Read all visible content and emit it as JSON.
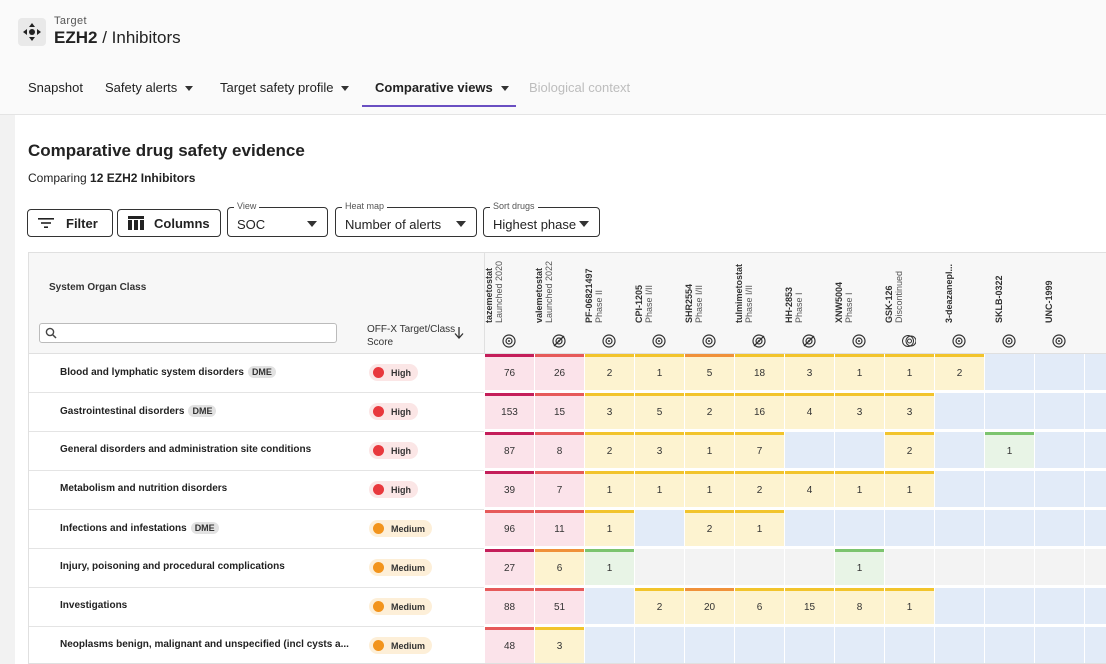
{
  "header": {
    "crumb_small": "Target",
    "target_name": "EZH2",
    "crumb_rest": "/ Inhibitors"
  },
  "tabs": [
    {
      "label": "Snapshot",
      "caret": false,
      "state": "normal"
    },
    {
      "label": "Safety alerts",
      "caret": true,
      "state": "normal"
    },
    {
      "label": "Target safety profile",
      "caret": true,
      "state": "normal"
    },
    {
      "label": "Comparative views",
      "caret": true,
      "state": "active"
    },
    {
      "label": "Biological context",
      "caret": false,
      "state": "disabled"
    }
  ],
  "panel": {
    "title": "Comparative drug safety evidence",
    "sub_prefix": "Comparing",
    "sub_bold": "12 EZH2 Inhibitors"
  },
  "toolbar": {
    "filter_label": "Filter",
    "columns_label": "Columns",
    "view": {
      "label": "View",
      "value": "SOC"
    },
    "heatmap": {
      "label": "Heat map",
      "value": "Number of alerts"
    },
    "sort": {
      "label": "Sort drugs",
      "value": "Highest phase"
    }
  },
  "table": {
    "soc_header": "System Organ Class",
    "score_header_line1": "OFF-X Target/Class",
    "score_header_line2": "Score",
    "drugs": [
      {
        "name": "tazemetostat",
        "phase": "Launched 2020",
        "icon": "target-icon"
      },
      {
        "name": "valemetostat",
        "phase": "Launched 2022",
        "icon": "target-crossed-icon"
      },
      {
        "name": "PF-06821497",
        "phase": "Phase II",
        "icon": "target-icon"
      },
      {
        "name": "CPI-1205",
        "phase": "Phase I/II",
        "icon": "target-icon"
      },
      {
        "name": "SHR2554",
        "phase": "Phase I/II",
        "icon": "target-icon"
      },
      {
        "name": "tulmimetostat",
        "phase": "Phase I/II",
        "icon": "target-crossed-icon"
      },
      {
        "name": "HH-2853",
        "phase": "Phase I",
        "icon": "target-crossed-icon"
      },
      {
        "name": "XNW5004",
        "phase": "Phase I",
        "icon": "target-icon"
      },
      {
        "name": "GSK-126",
        "phase": "Discontinued",
        "icon": "target-multi-icon"
      },
      {
        "name": "3-deazanepl...",
        "phase": "",
        "icon": "target-icon"
      },
      {
        "name": "SKLB-0322",
        "phase": "",
        "icon": "target-icon"
      },
      {
        "name": "UNC-1999",
        "phase": "",
        "icon": "target-icon"
      }
    ],
    "rows": [
      {
        "name": "Blood and lymphatic system disorders",
        "dme": "DME",
        "score": "High",
        "values": [
          "76",
          "26",
          "2",
          "1",
          "5",
          "18",
          "3",
          "1",
          "1",
          "2",
          "",
          ""
        ],
        "cell_fill": [
          "pk",
          "pk",
          "ye",
          "ye",
          "ye",
          "ye",
          "ye",
          "ye",
          "ye",
          "ye",
          "bl",
          "bl"
        ],
        "cell_bar": [
          "mg",
          "rd",
          "ye",
          "ye",
          "or",
          "ye",
          "ye",
          "ye",
          "ye",
          "ye",
          "",
          ""
        ]
      },
      {
        "name": "Gastrointestinal disorders",
        "dme": "DME",
        "score": "High",
        "values": [
          "153",
          "15",
          "3",
          "5",
          "2",
          "16",
          "4",
          "3",
          "3",
          "",
          "",
          ""
        ],
        "cell_fill": [
          "pk",
          "pk",
          "ye",
          "ye",
          "ye",
          "ye",
          "ye",
          "ye",
          "ye",
          "bl",
          "bl",
          "bl"
        ],
        "cell_bar": [
          "mg",
          "rd",
          "ye",
          "ye",
          "ye",
          "ye",
          "ye",
          "ye",
          "ye",
          "",
          "",
          ""
        ]
      },
      {
        "name": "General disorders and administration site conditions",
        "dme": "",
        "score": "High",
        "values": [
          "87",
          "8",
          "2",
          "3",
          "1",
          "7",
          "",
          "",
          "2",
          "",
          "1",
          ""
        ],
        "cell_fill": [
          "pk",
          "pk",
          "ye",
          "ye",
          "ye",
          "ye",
          "bl",
          "bl",
          "ye",
          "bl",
          "gn",
          "bl"
        ],
        "cell_bar": [
          "mg",
          "rd",
          "ye",
          "ye",
          "ye",
          "ye",
          "",
          "",
          "ye",
          "",
          "gn",
          ""
        ]
      },
      {
        "name": "Metabolism and nutrition disorders",
        "dme": "",
        "score": "High",
        "values": [
          "39",
          "7",
          "1",
          "1",
          "1",
          "2",
          "4",
          "1",
          "1",
          "",
          "",
          ""
        ],
        "cell_fill": [
          "pk",
          "pk",
          "ye",
          "ye",
          "ye",
          "ye",
          "ye",
          "ye",
          "ye",
          "bl",
          "bl",
          "bl"
        ],
        "cell_bar": [
          "mg",
          "rd",
          "ye",
          "ye",
          "ye",
          "ye",
          "ye",
          "ye",
          "ye",
          "",
          "",
          ""
        ]
      },
      {
        "name": "Infections and infestations",
        "dme": "DME",
        "score": "Medium",
        "values": [
          "96",
          "11",
          "1",
          "",
          "2",
          "1",
          "",
          "",
          "",
          "",
          "",
          ""
        ],
        "cell_fill": [
          "pk",
          "pk",
          "ye",
          "bl",
          "ye",
          "ye",
          "bl",
          "bl",
          "bl",
          "bl",
          "bl",
          "bl"
        ],
        "cell_bar": [
          "rd",
          "rd",
          "ye",
          "",
          "ye",
          "ye",
          "",
          "",
          "",
          "",
          "",
          ""
        ]
      },
      {
        "name": "Injury, poisoning and procedural complications",
        "dme": "",
        "score": "Medium",
        "values": [
          "27",
          "6",
          "1",
          "",
          "",
          "",
          "",
          "1",
          "",
          "",
          "",
          ""
        ],
        "cell_fill": [
          "pk",
          "ye",
          "gn",
          "gy",
          "gy",
          "gy",
          "gy",
          "gn",
          "gy",
          "gy",
          "gy",
          "gy"
        ],
        "cell_bar": [
          "mg",
          "or",
          "gn",
          "",
          "",
          "",
          "",
          "gn",
          "",
          "",
          "",
          ""
        ]
      },
      {
        "name": "Investigations",
        "dme": "",
        "score": "Medium",
        "values": [
          "88",
          "51",
          "",
          "2",
          "20",
          "6",
          "15",
          "8",
          "1",
          "",
          "",
          ""
        ],
        "cell_fill": [
          "pk",
          "pk",
          "bl",
          "ye",
          "ye",
          "ye",
          "ye",
          "ye",
          "ye",
          "bl",
          "bl",
          "bl"
        ],
        "cell_bar": [
          "rd",
          "rd",
          "",
          "ye",
          "or",
          "ye",
          "ye",
          "ye",
          "ye",
          "",
          "",
          ""
        ]
      },
      {
        "name": "Neoplasms benign, malignant and unspecified (incl cysts a...",
        "dme": "",
        "score": "Medium",
        "values": [
          "48",
          "3",
          "",
          "",
          "",
          "",
          "",
          "",
          "",
          "",
          "",
          ""
        ],
        "cell_fill": [
          "pk",
          "ye",
          "bl",
          "bl",
          "bl",
          "bl",
          "bl",
          "bl",
          "bl",
          "bl",
          "bl",
          "bl"
        ],
        "cell_bar": [
          "rd",
          "ye",
          "",
          "",
          "",
          "",
          "",
          "",
          "",
          "",
          "",
          ""
        ]
      }
    ]
  },
  "colors": {
    "accent": "#6a4fc2",
    "fill": {
      "pk": "#fbe3ea",
      "ye": "#fdf3d0",
      "bl": "#e2ebf8",
      "gn": "#e8f4e6",
      "gy": "#f3f3f3"
    },
    "bar": {
      "mg": "#c41e5a",
      "rd": "#e65a5a",
      "or": "#f0913a",
      "ye": "#f2c42c",
      "gn": "#7cc46e"
    },
    "score": {
      "High": {
        "bg": "#fbe6e6",
        "dot": "#e8383d"
      },
      "Medium": {
        "bg": "#fdefd8",
        "dot": "#f2941c"
      }
    }
  }
}
